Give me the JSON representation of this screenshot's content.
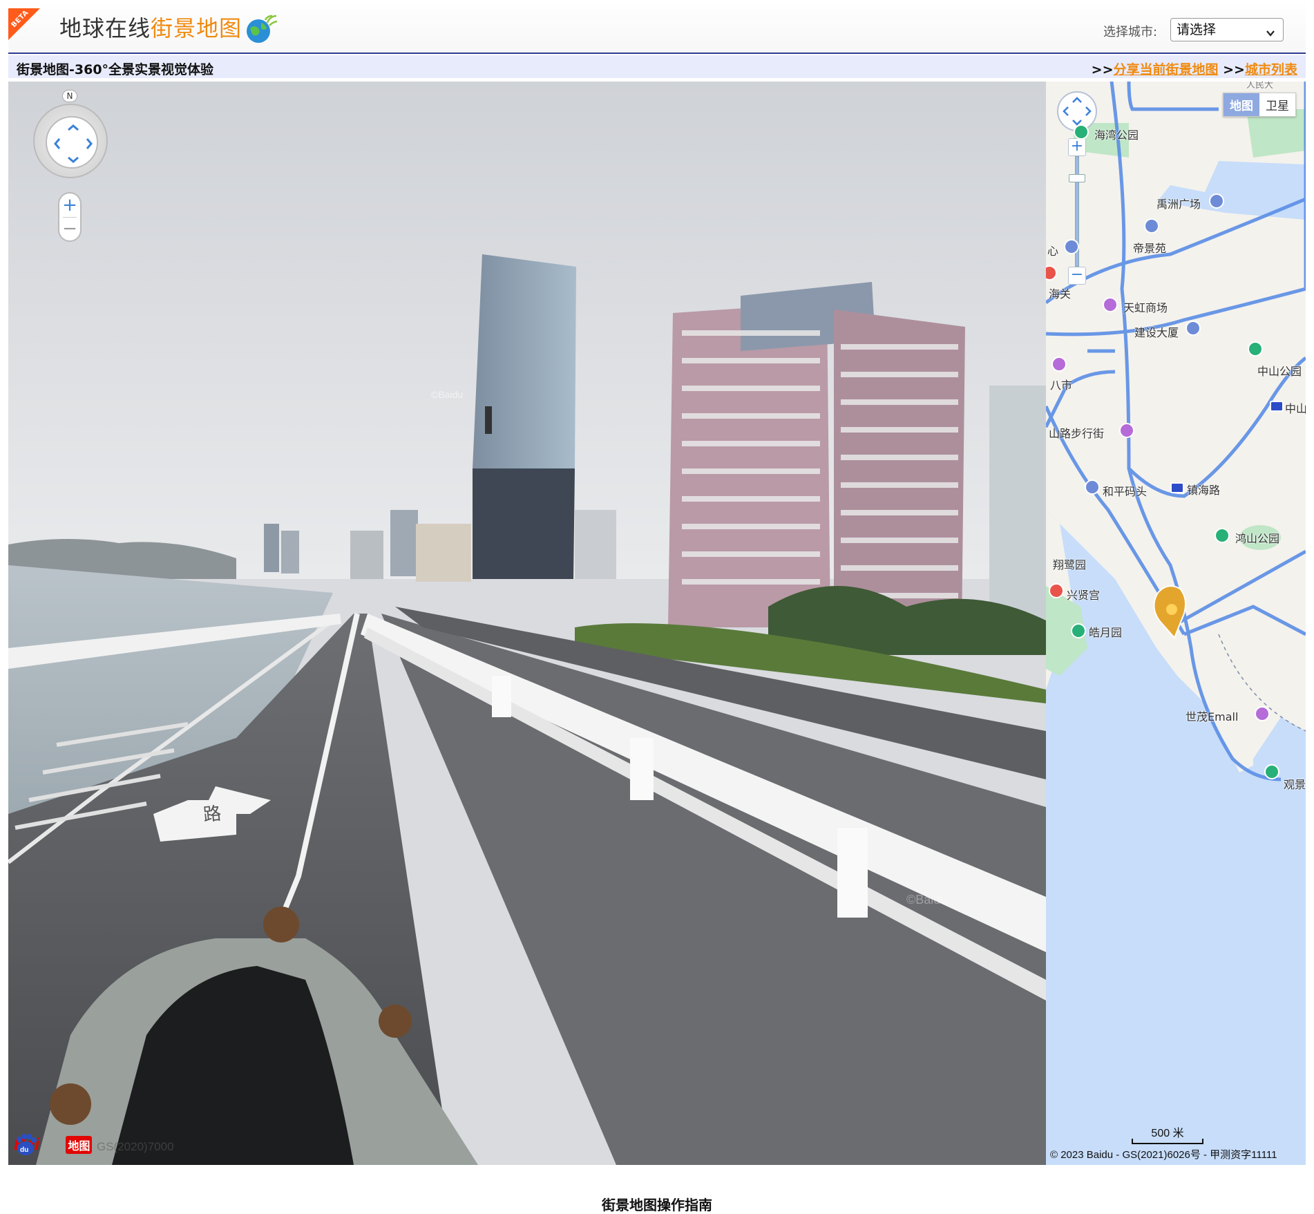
{
  "header": {
    "beta_badge": "BETA",
    "logo_text_dark": "地球在线",
    "logo_text_orange": "街景地图",
    "city_label": "选择城市:",
    "city_select_value": "请选择"
  },
  "titlebar": {
    "title": "街景地图-360°全景实景视觉体验",
    "prefix_1": ">>",
    "share_link": "分享当前街景地图",
    "prefix_2": ">>",
    "city_list_link": "城市列表"
  },
  "panorama": {
    "compass_letter": "N",
    "zoom_in": "+",
    "zoom_out": "−",
    "road_marking": "路",
    "baidu_logo_bai": "Bai",
    "baidu_logo_ditu": "地图",
    "approval_no": "GS(2020)7000"
  },
  "minimap": {
    "map_type_map": "地图",
    "map_type_satellite": "卫星",
    "labels": {
      "haiwan_park": "海湾公园",
      "yuzhou_plaza": "禹洲广场",
      "diyuan": "帝景苑",
      "xin": "心",
      "haiguan": "海关",
      "tianhong": "天虹商场",
      "jianshe": "建设大厦",
      "zhongshan_park": "中山公园",
      "bashi": "八市",
      "zhong": "中山",
      "walking_street": "山路步行街",
      "heping_pier": "和平码头",
      "zhenhai_road": "镇海路",
      "hongshan_park": "鸿山公园",
      "xianglu_yuan": "翔鹭园",
      "xingxian_palace": "兴贤宫",
      "haoyue_yuan": "皓月园",
      "shimao_emall": "世茂Emall",
      "guanjing": "观景",
      "top_cut": "人民大"
    },
    "scale_label": "500 米",
    "copyright": "© 2023 Baidu - GS(2021)6026号 - 甲测资字11111"
  },
  "footer": {
    "heading": "街景地图操作指南"
  },
  "colors": {
    "accent_orange": "#f08a10",
    "header_rule": "#2d3b8f",
    "titlebar_bg": "#e7ebfb",
    "map_water": "#c7ddfa",
    "map_road": "#5b8ee6"
  }
}
